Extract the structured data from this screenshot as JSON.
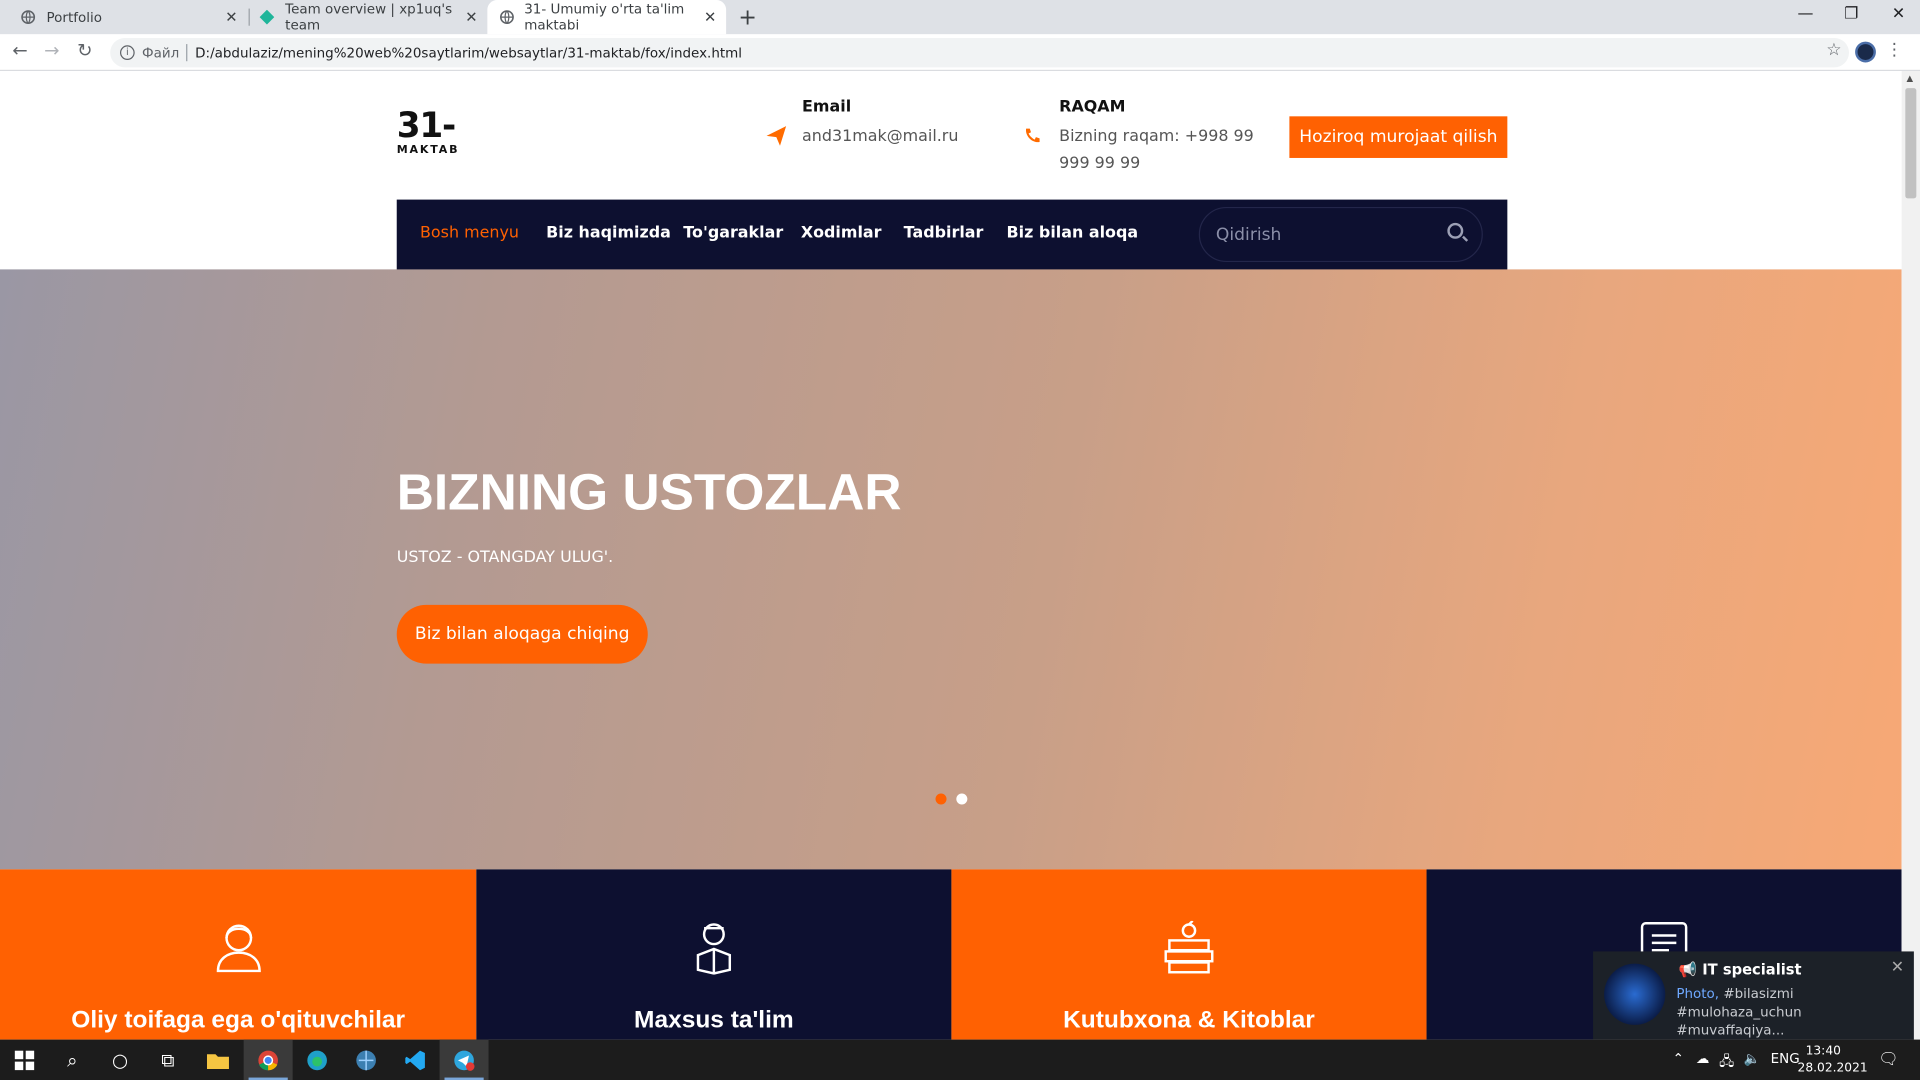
{
  "browser": {
    "tabs": [
      {
        "title": "Portfolio"
      },
      {
        "title": "Team overview | xp1uq's team"
      },
      {
        "title": "31- Umumiy o'rta ta'lim maktabi"
      }
    ],
    "url_prefix": "Файл",
    "url": "D:/abdulaziz/mening%20web%20saytlarim/websaytlar/31-maktab/fox/index.html"
  },
  "site": {
    "logo_big": "31-",
    "logo_small": "MAKTAB",
    "email_label": "Email",
    "email_value": "and31mak@mail.ru",
    "phone_label": "RAQAM",
    "phone_value": "Bizning raqam: +998 99 999 99 99",
    "cta": "Hoziroq murojaat qilish",
    "nav": [
      {
        "label": "Bosh menyu"
      },
      {
        "label": "Biz haqimizda"
      },
      {
        "label": "To'garaklar"
      },
      {
        "label": "Xodimlar"
      },
      {
        "label": "Tadbirlar"
      },
      {
        "label": "Biz bilan aloqa"
      }
    ],
    "search_placeholder": "Qidirish",
    "hero": {
      "title": "BIZNING USTOZLAR",
      "subtitle": "USTOZ - OTANGDAY ULUG'.",
      "button": "Biz bilan aloqaga chiqing"
    },
    "features": [
      {
        "title": "Oliy toifaga ega o'qituvchilar"
      },
      {
        "title": "Maxsus ta'lim"
      },
      {
        "title": "Kutubxona & Kitoblar"
      },
      {
        "title": ""
      }
    ],
    "colors": {
      "accent": "#ff6102",
      "navy": "#0d1030"
    }
  },
  "notification": {
    "title": "IT specialist",
    "line1_link": "Photo,",
    "line1_rest": " #bilasizmi",
    "line2": "#mulohaza_uchun #muvaffaqiya..."
  },
  "taskbar": {
    "language": "ENG",
    "time": "13:40",
    "date": "28.02.2021"
  }
}
